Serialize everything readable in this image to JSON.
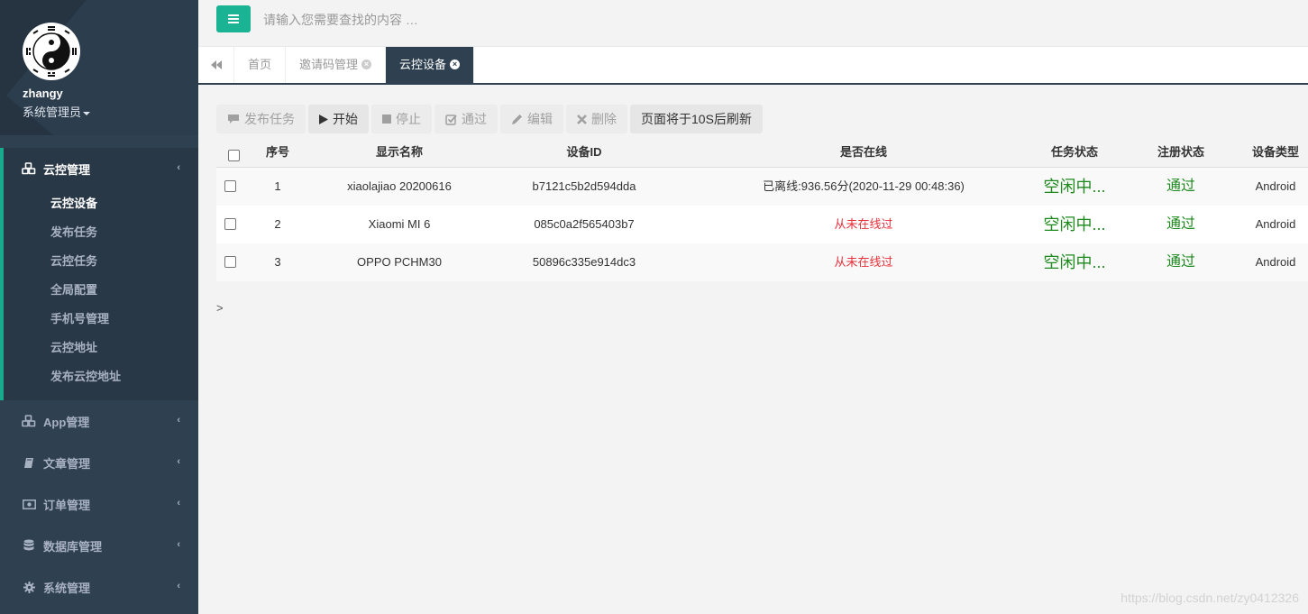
{
  "sidebar": {
    "username": "zhangy",
    "role": "系统管理员",
    "active_menu": {
      "label": "云控管理",
      "icon": "cubes-icon"
    },
    "submenu": [
      {
        "label": "云控设备",
        "current": true
      },
      {
        "label": "发布任务"
      },
      {
        "label": "云控任务"
      },
      {
        "label": "全局配置"
      },
      {
        "label": "手机号管理"
      },
      {
        "label": "云控地址"
      },
      {
        "label": "发布云控地址"
      }
    ],
    "menus": [
      {
        "label": "App管理",
        "icon": "cubes-icon"
      },
      {
        "label": "文章管理",
        "icon": "book-icon"
      },
      {
        "label": "订单管理",
        "icon": "money-icon"
      },
      {
        "label": "数据库管理",
        "icon": "database-icon"
      },
      {
        "label": "系统管理",
        "icon": "gear-icon"
      }
    ]
  },
  "topbar": {
    "search_placeholder": "请输入您需要查找的内容 …"
  },
  "tabs": {
    "items": [
      {
        "label": "首页",
        "closable": false
      },
      {
        "label": "邀请码管理",
        "closable": true
      },
      {
        "label": "云控设备",
        "closable": true,
        "active": true
      }
    ]
  },
  "toolbar": {
    "publish": "发布任务",
    "start": "开始",
    "stop": "停止",
    "approve": "通过",
    "edit": "编辑",
    "delete": "删除",
    "refresh_notice": "页面将于10S后刷新"
  },
  "table": {
    "headers": {
      "index": "序号",
      "name": "显示名称",
      "device_id": "设备ID",
      "online": "是否在线",
      "task_status": "任务状态",
      "reg_status": "注册状态",
      "device_type": "设备类型"
    },
    "rows": [
      {
        "index": "1",
        "name": "xiaolajiao 20200616",
        "device_id": "b7121c5b2d594dda",
        "online": "已离线:936.56分(2020-11-29 00:48:36)",
        "online_never": false,
        "task_status": "空闲中...",
        "reg_status": "通过",
        "device_type": "Android"
      },
      {
        "index": "2",
        "name": "Xiaomi MI 6",
        "device_id": "085c0a2f565403b7",
        "online": "从未在线过",
        "online_never": true,
        "task_status": "空闲中...",
        "reg_status": "通过",
        "device_type": "Android"
      },
      {
        "index": "3",
        "name": "OPPO PCHM30",
        "device_id": "50896c335e914dc3",
        "online": "从未在线过",
        "online_never": true,
        "task_status": "空闲中...",
        "reg_status": "通过",
        "device_type": "Android"
      }
    ]
  },
  "pager": {
    "text": ">"
  },
  "watermark": "https://blog.csdn.net/zy0412326",
  "colors": {
    "sidebar": "#2f4050",
    "accent": "#1ab394",
    "status_green": "#1e8a1e",
    "status_red": "#e8303a"
  }
}
